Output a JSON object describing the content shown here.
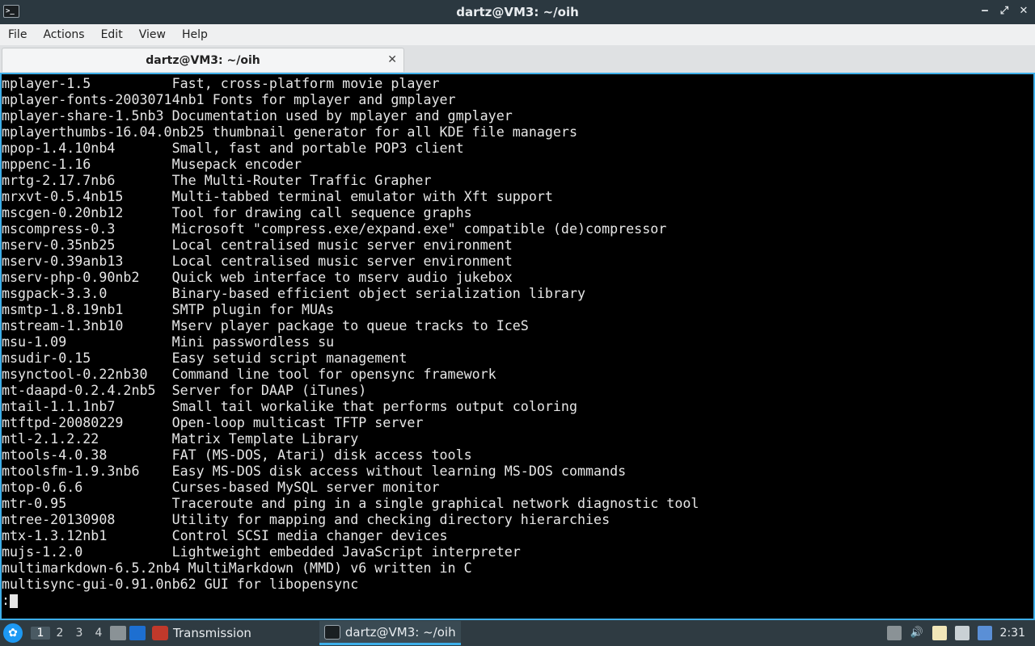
{
  "window": {
    "title": "dartz@VM3: ~/oih",
    "terminal_icon_text": ">_"
  },
  "menubar": {
    "items": [
      "File",
      "Actions",
      "Edit",
      "View",
      "Help"
    ]
  },
  "tab": {
    "label": "dartz@VM3: ~/oih",
    "close_glyph": "✕"
  },
  "terminal": {
    "lines": [
      "mplayer-1.5          Fast, cross-platform movie player",
      "mplayer-fonts-20030714nb1 Fonts for mplayer and gmplayer",
      "mplayer-share-1.5nb3 Documentation used by mplayer and gmplayer",
      "mplayerthumbs-16.04.0nb25 thumbnail generator for all KDE file managers",
      "mpop-1.4.10nb4       Small, fast and portable POP3 client",
      "mppenc-1.16          Musepack encoder",
      "mrtg-2.17.7nb6       The Multi-Router Traffic Grapher",
      "mrxvt-0.5.4nb15      Multi-tabbed terminal emulator with Xft support",
      "mscgen-0.20nb12      Tool for drawing call sequence graphs",
      "mscompress-0.3       Microsoft \"compress.exe/expand.exe\" compatible (de)compressor",
      "mserv-0.35nb25       Local centralised music server environment",
      "mserv-0.39anb13      Local centralised music server environment",
      "mserv-php-0.90nb2    Quick web interface to mserv audio jukebox",
      "msgpack-3.3.0        Binary-based efficient object serialization library",
      "msmtp-1.8.19nb1      SMTP plugin for MUAs",
      "mstream-1.3nb10      Mserv player package to queue tracks to IceS",
      "msu-1.09             Mini passwordless su",
      "msudir-0.15          Easy setuid script management",
      "msynctool-0.22nb30   Command line tool for opensync framework",
      "mt-daapd-0.2.4.2nb5  Server for DAAP (iTunes)",
      "mtail-1.1.1nb7       Small tail workalike that performs output coloring",
      "mtftpd-20080229      Open-loop multicast TFTP server",
      "mtl-2.1.2.22         Matrix Template Library",
      "mtools-4.0.38        FAT (MS-DOS, Atari) disk access tools",
      "mtoolsfm-1.9.3nb6    Easy MS-DOS disk access without learning MS-DOS commands",
      "mtop-0.6.6           Curses-based MySQL server monitor",
      "mtr-0.95             Traceroute and ping in a single graphical network diagnostic tool",
      "mtree-20130908       Utility for mapping and checking directory hierarchies",
      "mtx-1.3.12nb1        Control SCSI media changer devices",
      "mujs-1.2.0           Lightweight embedded JavaScript interpreter",
      "multimarkdown-6.5.2nb4 MultiMarkdown (MMD) v6 written in C",
      "multisync-gui-0.91.0nb62 GUI for libopensync"
    ],
    "prompt": ":"
  },
  "taskbar": {
    "workspaces": [
      "1",
      "2",
      "3",
      "4"
    ],
    "active_workspace": "1",
    "tasks": [
      {
        "label": "Transmission",
        "icon": "transmission-icon"
      },
      {
        "label": "dartz@VM3: ~/oih",
        "icon": "terminal-icon"
      }
    ],
    "clock": "2:31"
  },
  "colors": {
    "accent": "#3daee9",
    "terminal_bg": "#000000",
    "terminal_fg": "#e6e6e6"
  }
}
